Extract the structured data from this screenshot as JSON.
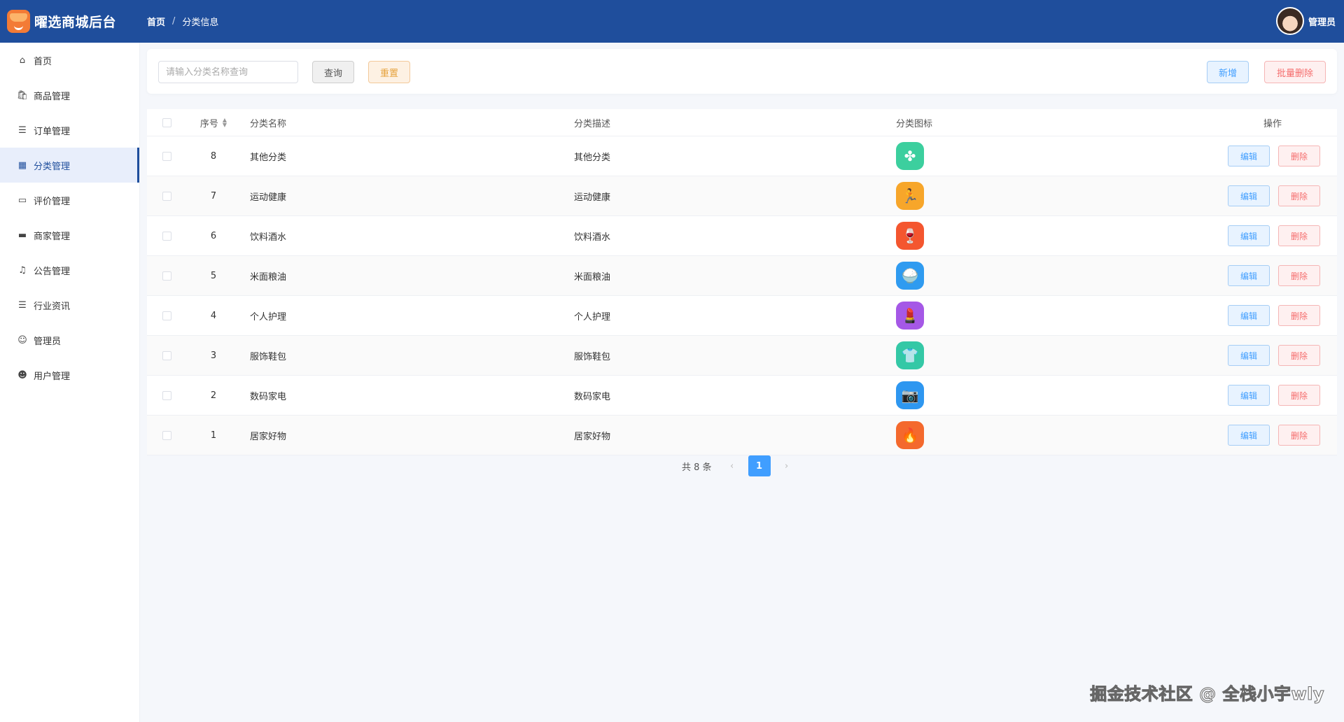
{
  "app": {
    "title": "曜选商城后台"
  },
  "breadcrumb": {
    "home": "首页",
    "separator": "/",
    "current": "分类信息"
  },
  "user": {
    "name": "管理员"
  },
  "sidebar": {
    "items": [
      {
        "label": "首页",
        "icon": "home-icon",
        "glyph": "⌂"
      },
      {
        "label": "商品管理",
        "icon": "shopping-bag-icon",
        "glyph": "🛍"
      },
      {
        "label": "订单管理",
        "icon": "document-icon",
        "glyph": "☰"
      },
      {
        "label": "分类管理",
        "icon": "grid-icon",
        "glyph": "▦",
        "active": true
      },
      {
        "label": "评价管理",
        "icon": "comment-icon",
        "glyph": "▭"
      },
      {
        "label": "商家管理",
        "icon": "store-icon",
        "glyph": "▬"
      },
      {
        "label": "公告管理",
        "icon": "bell-icon",
        "glyph": "♫"
      },
      {
        "label": "行业资讯",
        "icon": "news-icon",
        "glyph": "☰"
      },
      {
        "label": "管理员",
        "icon": "user-outline-icon",
        "glyph": "☺"
      },
      {
        "label": "用户管理",
        "icon": "user-icon",
        "glyph": "☻"
      }
    ]
  },
  "toolbar": {
    "search_placeholder": "请输入分类名称查询",
    "query_label": "查询",
    "reset_label": "重置",
    "add_label": "新增",
    "batch_delete_label": "批量删除"
  },
  "table": {
    "headers": {
      "no": "序号",
      "name": "分类名称",
      "desc": "分类描述",
      "icon": "分类图标",
      "op": "操作"
    },
    "edit_label": "编辑",
    "delete_label": "删除",
    "rows": [
      {
        "no": "8",
        "name": "其他分类",
        "desc": "其他分类",
        "icon": "clover-icon",
        "glyph": "✤",
        "color": "#3ccf9e"
      },
      {
        "no": "7",
        "name": "运动健康",
        "desc": "运动健康",
        "icon": "running-icon",
        "glyph": "🏃",
        "color": "#f7a62a"
      },
      {
        "no": "6",
        "name": "饮料酒水",
        "desc": "饮料酒水",
        "icon": "wine-icon",
        "glyph": "🍷",
        "color": "#f4562f"
      },
      {
        "no": "5",
        "name": "米面粮油",
        "desc": "米面粮油",
        "icon": "rice-cooker-icon",
        "glyph": "🍚",
        "color": "#2f9bf0"
      },
      {
        "no": "4",
        "name": "个人护理",
        "desc": "个人护理",
        "icon": "cosmetics-icon",
        "glyph": "💄",
        "color": "#a558e6"
      },
      {
        "no": "3",
        "name": "服饰鞋包",
        "desc": "服饰鞋包",
        "icon": "tshirt-icon",
        "glyph": "👕",
        "color": "#34c8a6"
      },
      {
        "no": "2",
        "name": "数码家电",
        "desc": "数码家电",
        "icon": "camera-icon",
        "glyph": "📷",
        "color": "#2e97f0"
      },
      {
        "no": "1",
        "name": "居家好物",
        "desc": "居家好物",
        "icon": "flame-icon",
        "glyph": "🔥",
        "color": "#f4692d"
      }
    ]
  },
  "pagination": {
    "total_text": "共 8 条",
    "current_page": "1",
    "prev": "‹",
    "next": "›"
  },
  "watermark": "掘金技术社区 @ 全栈小宇wly"
}
